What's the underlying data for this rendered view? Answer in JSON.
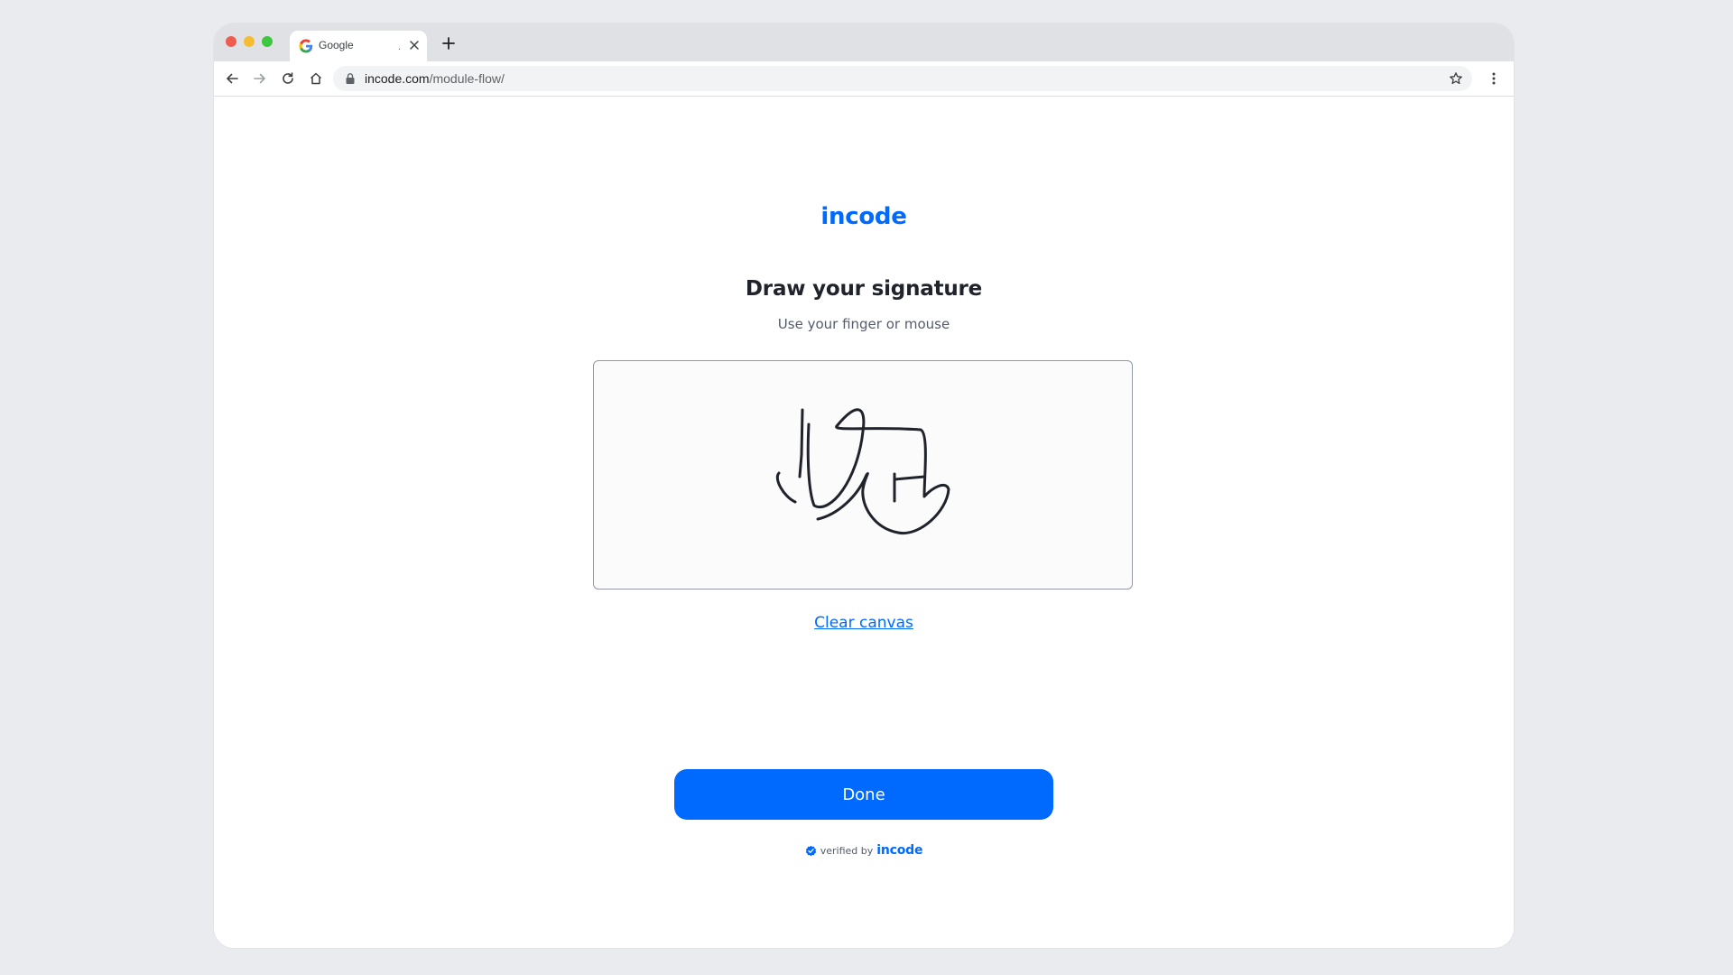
{
  "browser": {
    "tab_title": "Google",
    "tab_indicator": ".",
    "url_host": "incode.com",
    "url_path": "/module-flow/"
  },
  "page": {
    "brand": "incode",
    "title": "Draw your signature",
    "subtitle": "Use your finger or mouse",
    "clear_label": "Clear canvas",
    "done_label": "Done",
    "verified_prefix": "verified by",
    "verified_brand": "incode"
  },
  "colors": {
    "accent": "#006aff",
    "ink": "#20232b",
    "canvas_bg": "#fbfbfc",
    "canvas_border": "#9498a8"
  },
  "icons": {
    "back": "arrow-left-icon",
    "forward": "arrow-right-icon",
    "reload": "reload-icon",
    "home": "home-icon",
    "lock": "lock-icon",
    "bookmark": "star-icon",
    "menu": "kebab-menu-icon",
    "verified": "verified-check-icon"
  }
}
